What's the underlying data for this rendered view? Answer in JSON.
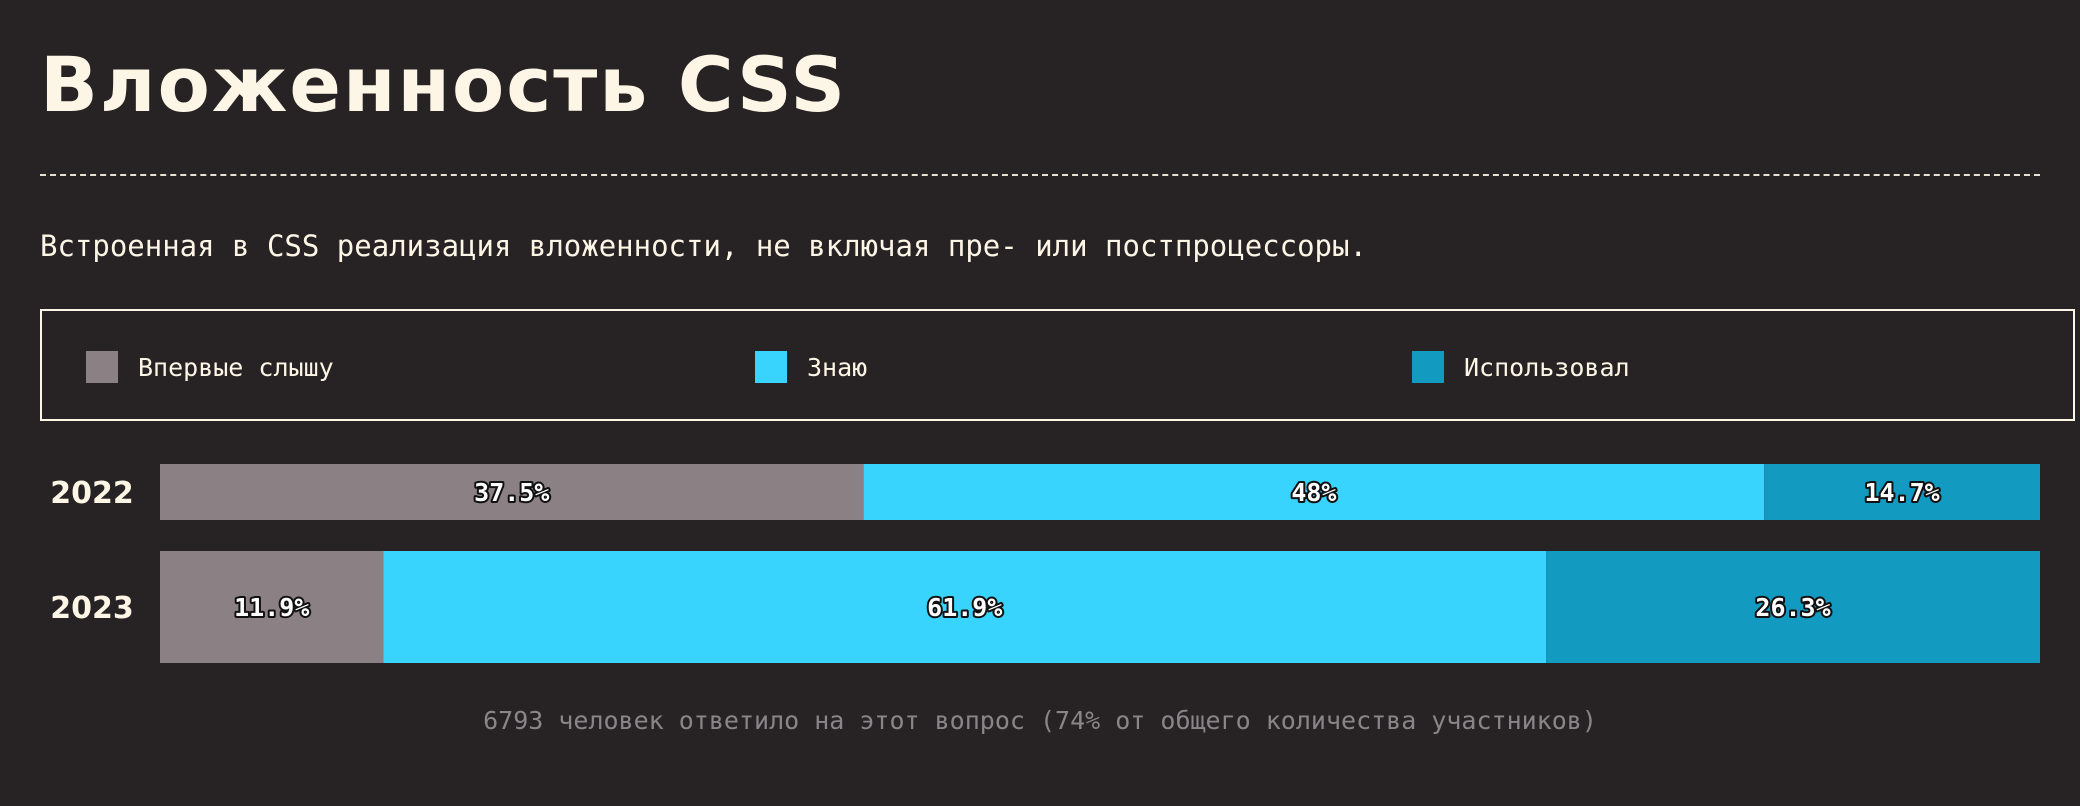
{
  "title": "Вложенность CSS",
  "subtitle": "Встроенная в CSS реализация вложенности, не включая пре- или постпроцессоры.",
  "legend": {
    "items": [
      {
        "label": "Впервые слышу",
        "color": "#8b8184"
      },
      {
        "label": "Знаю",
        "color": "#38d4fd"
      },
      {
        "label": "Использовал",
        "color": "#139ac1"
      }
    ]
  },
  "footnote": "6793 человек ответило на этот вопрос (74% от общего количества участников)",
  "chart_data": {
    "type": "bar",
    "orientation": "horizontal",
    "stacked": true,
    "title": "Вложенность CSS",
    "categories": [
      "2022",
      "2023"
    ],
    "series": [
      {
        "name": "Впервые слышу",
        "values": [
          37.5,
          11.9
        ],
        "labels": [
          "37.5%",
          "11.9%"
        ],
        "color": "#8b8184"
      },
      {
        "name": "Знаю",
        "values": [
          48,
          61.9
        ],
        "labels": [
          "48%",
          "61.9%"
        ],
        "color": "#38d4fd"
      },
      {
        "name": "Использовал",
        "values": [
          14.7,
          26.3
        ],
        "labels": [
          "14.7%",
          "26.3%"
        ],
        "color": "#139ac1"
      }
    ],
    "xlim": [
      0,
      100
    ],
    "grid": false,
    "legend_position": "top"
  }
}
